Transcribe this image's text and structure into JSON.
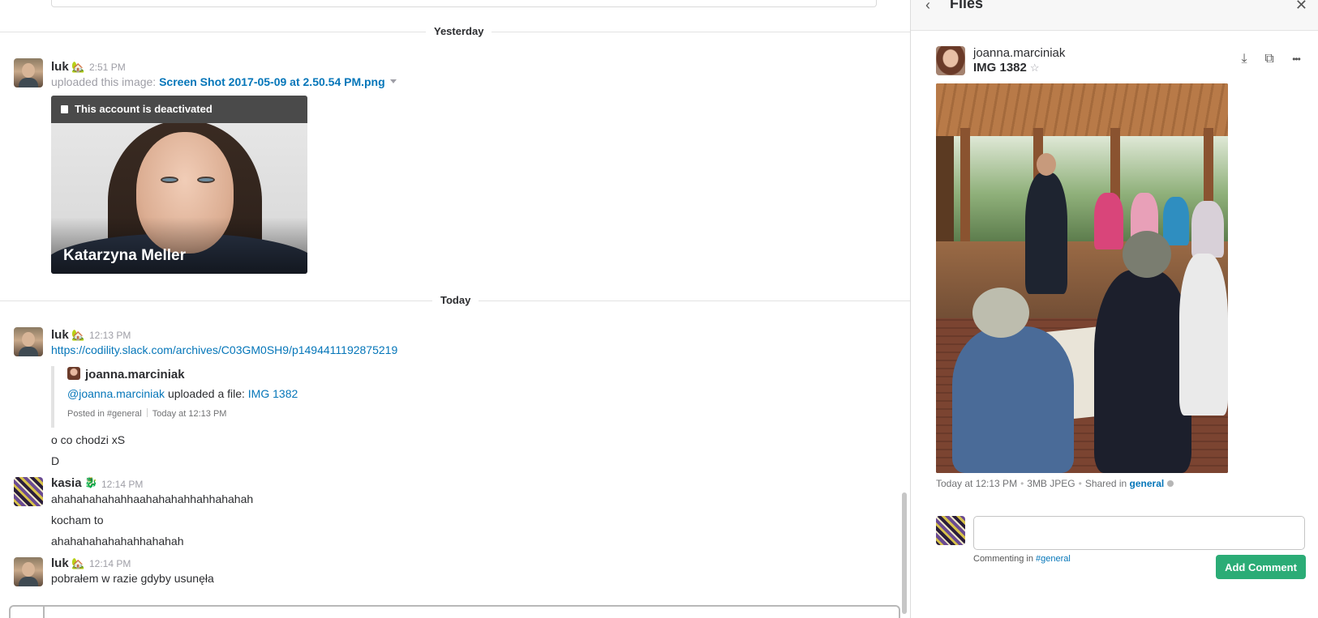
{
  "chat": {
    "day_dividers": {
      "yesterday": "Yesterday",
      "today": "Today"
    },
    "messages": [
      {
        "author": "luk",
        "status_emoji": "🏡",
        "time": "2:51 PM",
        "upload_prefix": "uploaded this image:",
        "file_link": "Screen Shot 2017-05-09 at 2.50.54 PM.png",
        "image_card": {
          "banner": "This account is deactivated",
          "name": "Katarzyna Meller"
        }
      },
      {
        "author": "luk",
        "status_emoji": "🏡",
        "time": "12:13 PM",
        "link": "https://codility.slack.com/archives/C03GM0SH9/p1494411192875219",
        "attachment": {
          "author": "joanna.marciniak",
          "mention": "@joanna.marciniak",
          "body_text": "uploaded a file:",
          "file": "IMG 1382",
          "posted_in": "Posted in #general",
          "posted_at": "Today at 12:13 PM"
        },
        "lines": [
          "o co chodzi xS",
          "D"
        ]
      },
      {
        "author": "kasia",
        "status_emoji": "🐉",
        "time": "12:14 PM",
        "lines": [
          "ahahahahahahhaahahahahhahhahahah",
          "kocham to",
          "ahahahahahahahhahahah"
        ]
      },
      {
        "author": "luk",
        "status_emoji": "🏡",
        "time": "12:14 PM",
        "lines": [
          "pobrałem w razie gdyby usunęła"
        ]
      }
    ]
  },
  "files_panel": {
    "title": "Files",
    "back_icon": "‹",
    "close_icon": "✕",
    "owner": "joanna.marciniak",
    "file_name": "IMG 1382",
    "star_icon": "☆",
    "action_icons": {
      "download": "⤓",
      "open_external": "⧉",
      "more": "•••"
    },
    "meta": {
      "time": "Today at 12:13 PM",
      "size": "3MB JPEG",
      "shared_prefix": "Shared in",
      "channel": "general"
    },
    "comment": {
      "placeholder": "",
      "hint_prefix": "Commenting in",
      "hint_channel": "#general",
      "button": "Add Comment"
    }
  },
  "colors": {
    "link": "#0576b9",
    "add_comment_button": "#2bac76",
    "muted_text": "#9e9ea6"
  }
}
